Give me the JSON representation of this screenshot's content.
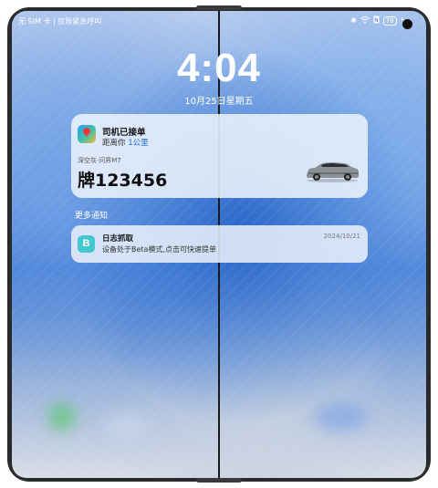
{
  "status_bar": {
    "carrier": "无 SIM 卡 | 仅限紧急呼叫",
    "battery": "78"
  },
  "lock_screen": {
    "time": "4:04",
    "date": "10月25日星期五"
  },
  "ride_notification": {
    "title": "司机已接单",
    "distance_prefix": "距离你",
    "distance_value": "1公里",
    "car_model": "深空灰·问界M7",
    "plate": "牌123456"
  },
  "more_notifications_label": "更多通知",
  "log_notification": {
    "icon_letter": "B",
    "title": "日志抓取",
    "date": "2024/10/21",
    "body": "设备处于Beta模式,点击可快速提单"
  },
  "icons": {
    "bluetooth": "bluetooth-icon",
    "wifi": "wifi-icon",
    "nfc": "nfc-icon",
    "charging": "charging-icon"
  }
}
